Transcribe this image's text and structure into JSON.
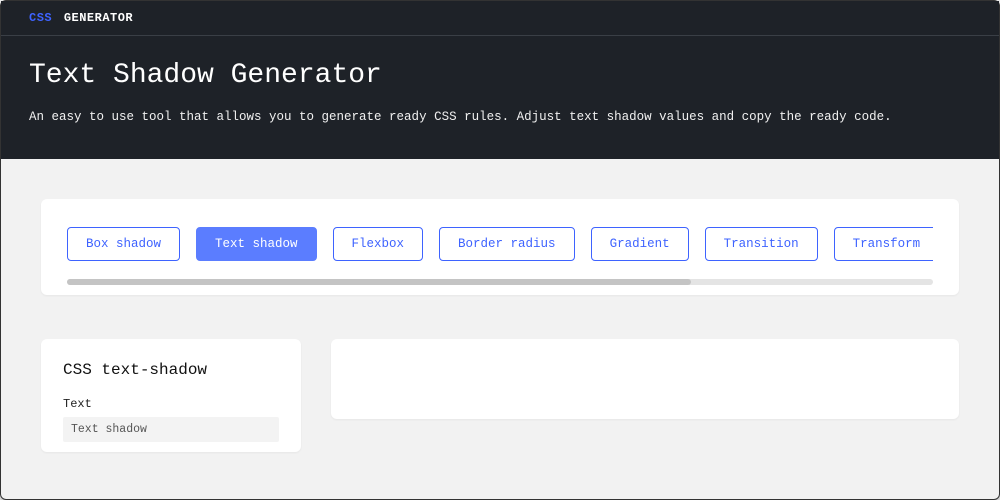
{
  "brand": {
    "prefix": "CSS",
    "suffix": "GENERATOR"
  },
  "hero": {
    "title": "Text Shadow Generator",
    "subtitle": "An easy to use tool that allows you to generate ready CSS rules. Adjust text shadow values and copy the ready code."
  },
  "tabs": {
    "items": [
      {
        "label": "Box shadow",
        "active": false
      },
      {
        "label": "Text shadow",
        "active": true
      },
      {
        "label": "Flexbox",
        "active": false
      },
      {
        "label": "Border radius",
        "active": false
      },
      {
        "label": "Gradient",
        "active": false
      },
      {
        "label": "Transition",
        "active": false
      },
      {
        "label": "Transform",
        "active": false
      }
    ],
    "scroll_percent": 72
  },
  "controls": {
    "heading": "CSS text-shadow",
    "text_field": {
      "label": "Text",
      "value": "Text shadow"
    }
  },
  "colors": {
    "accent": "#3e63ff",
    "accent_fill": "#5b7dff",
    "dark_bg": "#1e2228"
  }
}
